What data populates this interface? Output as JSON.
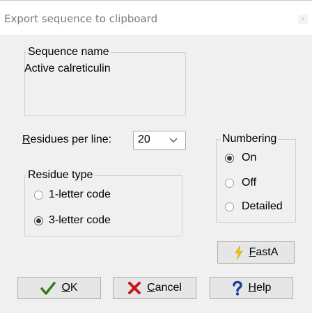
{
  "window": {
    "title": "Export sequence to clipboard",
    "close_glyph": "×"
  },
  "sequence_name": {
    "legend": "Sequence name",
    "value": "Active calreticulin"
  },
  "residues_per_line": {
    "label_mnemonic": "R",
    "label_rest": "esidues per line:",
    "value": "20"
  },
  "residue_type": {
    "legend": "Residue type",
    "options": [
      {
        "label": "1-letter code",
        "checked": false
      },
      {
        "label": "3-letter code",
        "checked": true
      }
    ]
  },
  "numbering": {
    "legend": "Numbering",
    "options": [
      {
        "label": "On",
        "checked": true
      },
      {
        "label": "Off",
        "checked": false
      },
      {
        "label": "Detailed",
        "checked": false
      }
    ]
  },
  "buttons": {
    "fasta": {
      "mnemonic": "F",
      "rest": "astA",
      "icon": "lightning-icon"
    },
    "ok": {
      "mnemonic": "O",
      "rest": "K",
      "icon": "checkmark-icon"
    },
    "cancel": {
      "mnemonic": "C",
      "rest": "ancel",
      "icon": "x-mark-icon"
    },
    "help": {
      "mnemonic": "H",
      "rest": "elp",
      "icon": "question-mark-icon"
    }
  },
  "colors": {
    "ok_check": "#2f7d1a",
    "cancel_x": "#c8171c",
    "help_q": "#1d3f9e",
    "fasta_bolt": "#f5c400"
  }
}
